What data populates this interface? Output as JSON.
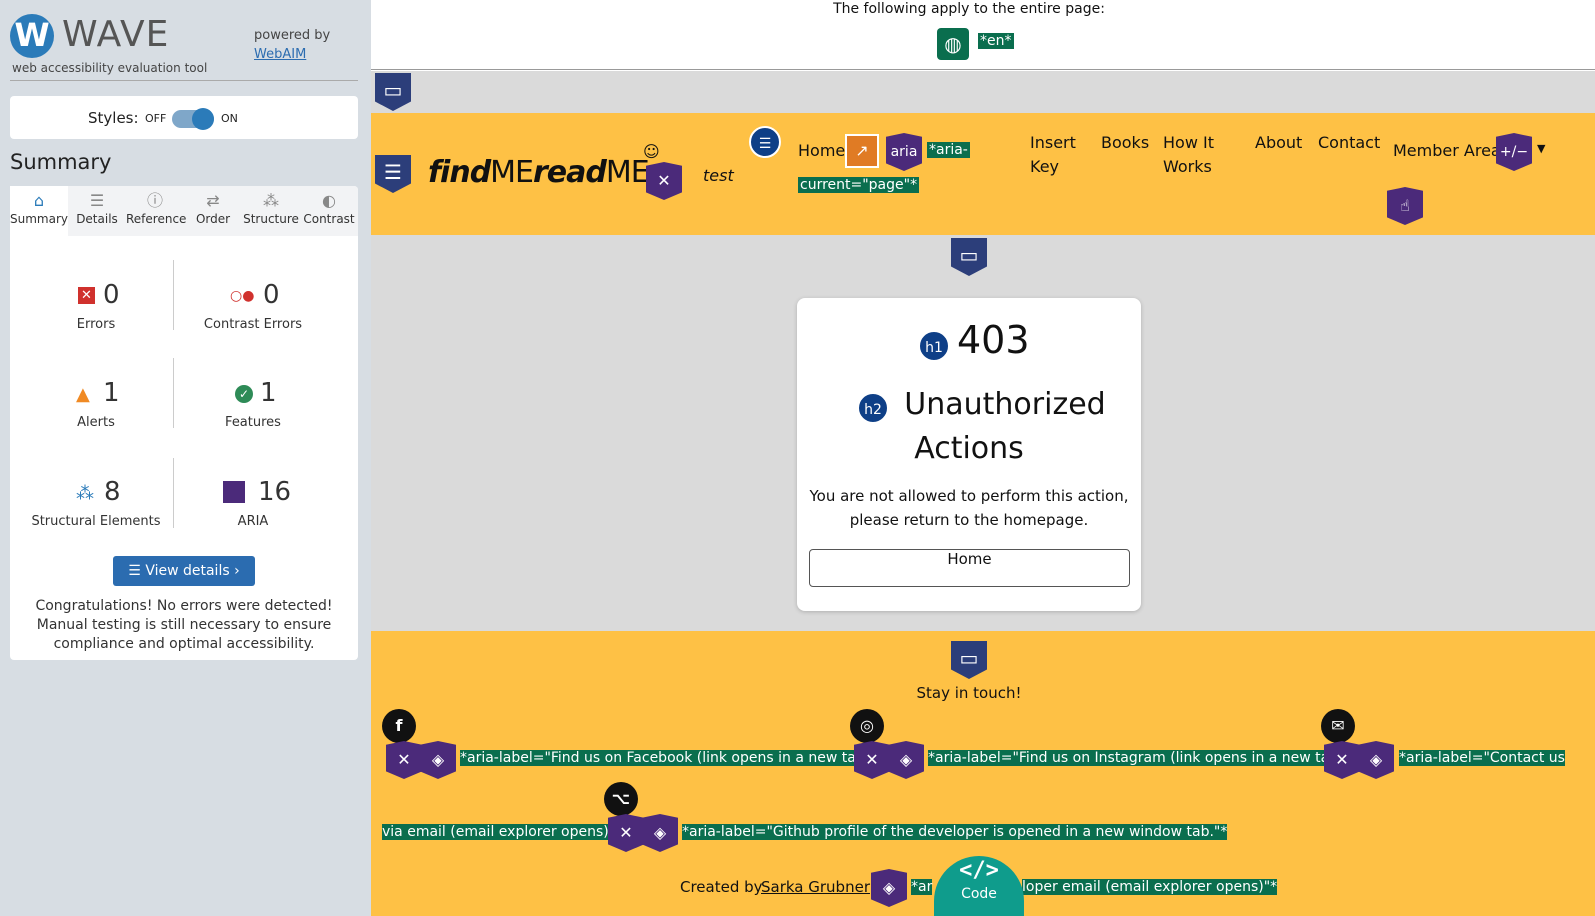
{
  "wave": {
    "logo_letter": "W",
    "logo_name": "WAVE",
    "subtitle": "web accessibility evaluation tool",
    "powered_by": "powered by",
    "webaim": "WebAIM",
    "styles_label": "Styles:",
    "styles_off": "OFF",
    "styles_on": "ON",
    "summary_heading": "Summary",
    "tabs": [
      {
        "label": "Summary",
        "icon": "home-icon"
      },
      {
        "label": "Details",
        "icon": "list-icon"
      },
      {
        "label": "Reference",
        "icon": "info-icon"
      },
      {
        "label": "Order",
        "icon": "order-icon"
      },
      {
        "label": "Structure",
        "icon": "structure-icon"
      },
      {
        "label": "Contrast",
        "icon": "contrast-icon"
      }
    ],
    "stats": {
      "errors": {
        "value": "0",
        "label": "Errors"
      },
      "contrast_errors": {
        "value": "0",
        "label": "Contrast Errors"
      },
      "alerts": {
        "value": "1",
        "label": "Alerts"
      },
      "features": {
        "value": "1",
        "label": "Features"
      },
      "structural": {
        "value": "8",
        "label": "Structural Elements"
      },
      "aria": {
        "value": "16",
        "label": "ARIA"
      }
    },
    "view_details": "View details ›",
    "congrats": "Congratulations! No errors were detected! Manual testing is still necessary to ensure compliance and optimal accessibility."
  },
  "page": {
    "applies_text": "The following apply to the entire page:",
    "lang_tag": "*en*",
    "brand_find": "find",
    "brand_me1": "ME",
    "brand_read": "read",
    "brand_me2": "ME",
    "user_name": "test",
    "nav": {
      "home": "Home",
      "aria_badge": "aria",
      "aria_current_1": "*aria-",
      "aria_current_2": "current=\"page\"*",
      "insert_key_1": "Insert",
      "insert_key_2": "Key",
      "books": "Books",
      "how_1": "How It",
      "how_2": "Works",
      "about": "About",
      "contact": "Contact",
      "member": "Member Area",
      "plusminus": "+/−"
    },
    "card": {
      "h1_badge": "h1",
      "code": "403",
      "h2_badge": "h2",
      "title_1": "Unauthorized",
      "title_2": "Actions",
      "message_1": "You are not allowed to perform this action,",
      "message_2": "please return to the homepage.",
      "button": "Home"
    },
    "footer": {
      "stay": "Stay in touch!",
      "facebook": "*aria-label=\"Find us on Facebook (link opens in a new tab)\"*",
      "instagram": "*aria-label=\"Find us on Instagram (link opens in a new tab)\"*",
      "contact_1": "*aria-label=\"Contact us",
      "contact_2": "via email (email explorer opens)\"*",
      "github": "*aria-label=\"Github profile of the developer is opened in a new window tab.\"*",
      "created_by": "Created by",
      "author": "Sarka Grubner",
      "dev_email_a": "*ar",
      "dev_email_b": "loper email (email explorer opens)\"*",
      "code_icon": "</>",
      "code_label": "Code"
    }
  },
  "colors": {
    "wave_blue": "#2b7bb9",
    "header_yellow": "#fec145",
    "aria_green": "#0a6e4e",
    "aria_purple": "#4b2a7a",
    "error_red": "#d0312d",
    "alert_orange": "#f08a24"
  }
}
